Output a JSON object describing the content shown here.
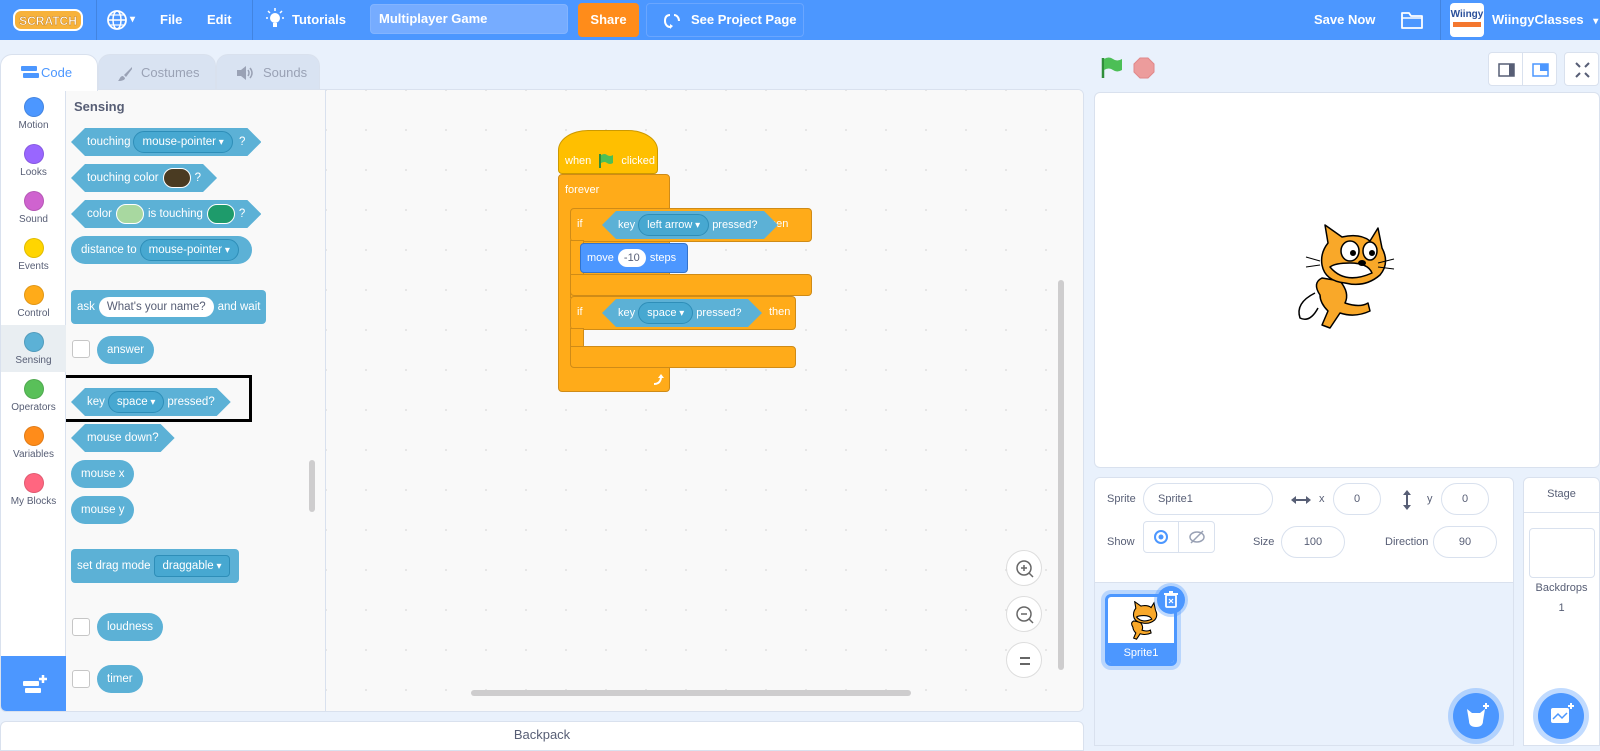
{
  "menubar": {
    "logo": "Scratch",
    "file": "File",
    "edit": "Edit",
    "tutorials": "Tutorials",
    "project_title": "Multiplayer Game",
    "share": "Share",
    "see_project_page": "See Project Page",
    "save_now": "Save Now",
    "username": "WiingyClasses",
    "avatar_text": "Wiingy"
  },
  "tabs": [
    {
      "label": "Code",
      "active": true
    },
    {
      "label": "Costumes",
      "active": false
    },
    {
      "label": "Sounds",
      "active": false
    }
  ],
  "categories": [
    {
      "label": "Motion",
      "color": "#4c97ff"
    },
    {
      "label": "Looks",
      "color": "#9966ff"
    },
    {
      "label": "Sound",
      "color": "#cf63cf"
    },
    {
      "label": "Events",
      "color": "#ffd500"
    },
    {
      "label": "Control",
      "color": "#ffab19"
    },
    {
      "label": "Sensing",
      "color": "#5cb1d6",
      "selected": true
    },
    {
      "label": "Operators",
      "color": "#59c059"
    },
    {
      "label": "Variables",
      "color": "#ff8c1a"
    },
    {
      "label": "My Blocks",
      "color": "#ff6680"
    }
  ],
  "palette": {
    "title": "Sensing",
    "touching": {
      "text": "touching",
      "menu": "mouse-pointer",
      "q": "?"
    },
    "touching_color": {
      "text": "touching color",
      "q": "?",
      "swatch": "#4a3b22"
    },
    "color_touching": {
      "text1": "color",
      "text2": "is touching",
      "q": "?",
      "swatch1": "#a8d8a0",
      "swatch2": "#1e9b6b"
    },
    "distance": {
      "text": "distance to",
      "menu": "mouse-pointer"
    },
    "ask": {
      "text1": "ask",
      "input": "What's your name?",
      "text2": "and wait"
    },
    "answer": "answer",
    "key_pressed": {
      "text1": "key",
      "menu": "space",
      "text2": "pressed?"
    },
    "mouse_down": "mouse down?",
    "mouse_x": "mouse x",
    "mouse_y": "mouse y",
    "drag_mode": {
      "text": "set drag mode",
      "menu": "draggable"
    },
    "loudness": "loudness",
    "timer": "timer"
  },
  "script": {
    "hat": {
      "text1": "when",
      "text2": "clicked"
    },
    "forever": "forever",
    "if1": {
      "if": "if",
      "key": "key",
      "menu": "left arrow",
      "pressed": "pressed?",
      "then": "then"
    },
    "move": {
      "text1": "move",
      "value": "-10",
      "text2": "steps"
    },
    "if2": {
      "if": "if",
      "key": "key",
      "menu": "space",
      "pressed": "pressed?",
      "then": "then"
    }
  },
  "backpack": "Backpack",
  "sprite_info": {
    "sprite_label": "Sprite",
    "sprite_name": "Sprite1",
    "x_label": "x",
    "x_value": "0",
    "y_label": "y",
    "y_value": "0",
    "show_label": "Show",
    "size_label": "Size",
    "size_value": "100",
    "direction_label": "Direction",
    "direction_value": "90"
  },
  "sprites": [
    {
      "name": "Sprite1",
      "selected": true
    }
  ],
  "stage_pane": {
    "title": "Stage",
    "backdrops_label": "Backdrops",
    "backdrops_count": "1"
  }
}
